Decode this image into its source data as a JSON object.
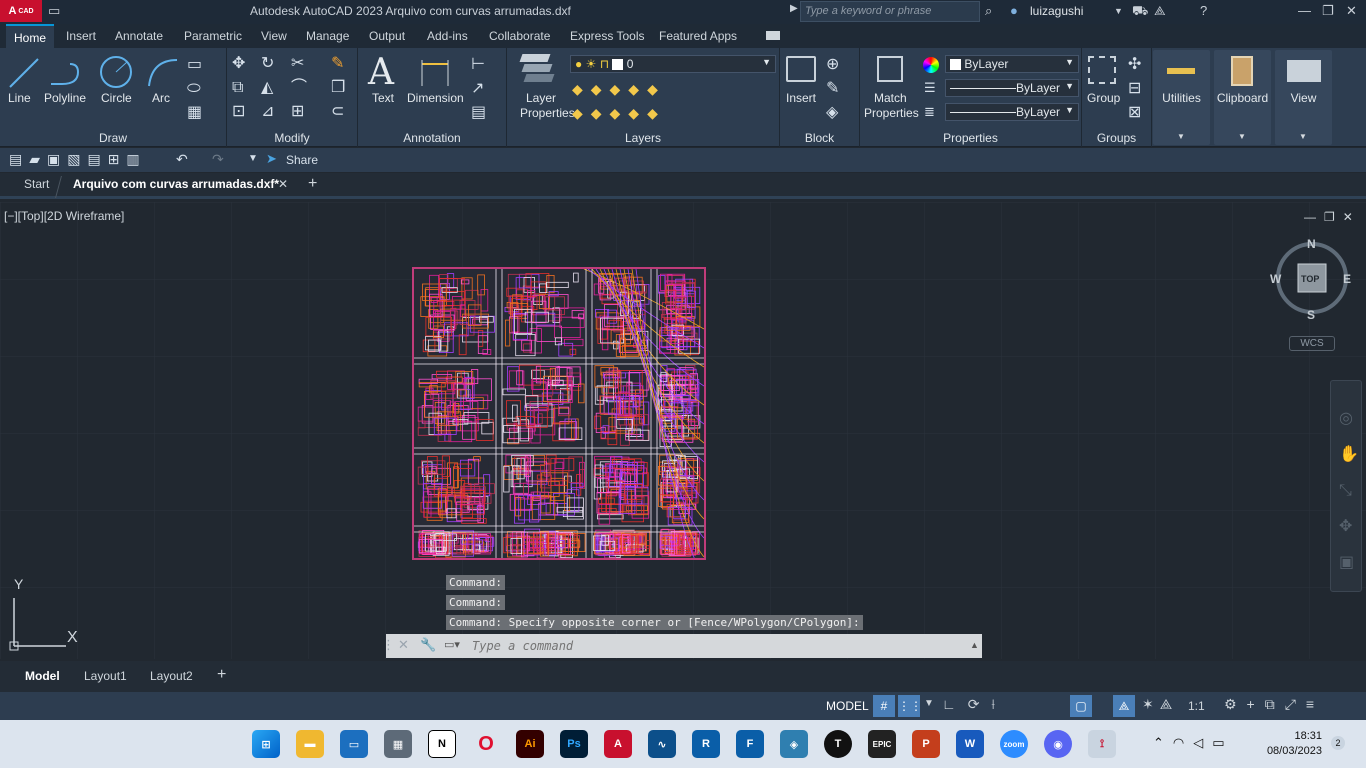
{
  "titlebar": {
    "logo": "A",
    "logo_sub": "CAD",
    "title": "Autodesk AutoCAD 2023    Arquivo com curvas arrumadas.dxf",
    "search_placeholder": "Type a keyword or phrase",
    "user": "luizagushi"
  },
  "ribbon_tabs": [
    "Home",
    "Insert",
    "Annotate",
    "Parametric",
    "View",
    "Manage",
    "Output",
    "Add-ins",
    "Collaborate",
    "Express Tools",
    "Featured Apps"
  ],
  "ribbon": {
    "draw": {
      "title": "Draw",
      "line": "Line",
      "polyline": "Polyline",
      "circle": "Circle",
      "arc": "Arc"
    },
    "modify": {
      "title": "Modify"
    },
    "annotation": {
      "title": "Annotation",
      "text": "Text",
      "dimension": "Dimension"
    },
    "layers": {
      "title": "Layers",
      "layer_properties_1": "Layer",
      "layer_properties_2": "Properties",
      "current_layer": "0"
    },
    "block": {
      "title": "Block",
      "insert": "Insert"
    },
    "properties": {
      "title": "Properties",
      "match_1": "Match",
      "match_2": "Properties",
      "color": "ByLayer",
      "linetype": "ByLayer",
      "lineweight": "ByLayer"
    },
    "groups": {
      "title": "Groups",
      "group": "Group"
    },
    "utilities": "Utilities",
    "clipboard": "Clipboard",
    "view": "View"
  },
  "qat": {
    "share": "Share"
  },
  "file_tabs": {
    "start": "Start",
    "current": "Arquivo com curvas arrumadas.dxf*"
  },
  "viewport": {
    "info": "[−][Top][2D Wireframe]",
    "compass": {
      "n": "N",
      "s": "S",
      "e": "E",
      "w": "W",
      "top": "TOP"
    },
    "wcs": "WCS",
    "ucs_x": "X",
    "ucs_y": "Y"
  },
  "command": {
    "history": [
      "Command:",
      "Command:",
      "Command: Specify opposite corner or [Fence/WPolygon/CPolygon]:"
    ],
    "placeholder": "Type a command"
  },
  "layout_tabs": [
    "Model",
    "Layout1",
    "Layout2"
  ],
  "status": {
    "model": "MODEL",
    "scale": "1:1"
  },
  "clock": {
    "time": "18:31",
    "date": "08/03/2023",
    "notifications": "2"
  },
  "colors": {
    "accent": "#0696d7",
    "drawing_magenta": "#e0209a",
    "drawing_red": "#e8302c"
  }
}
